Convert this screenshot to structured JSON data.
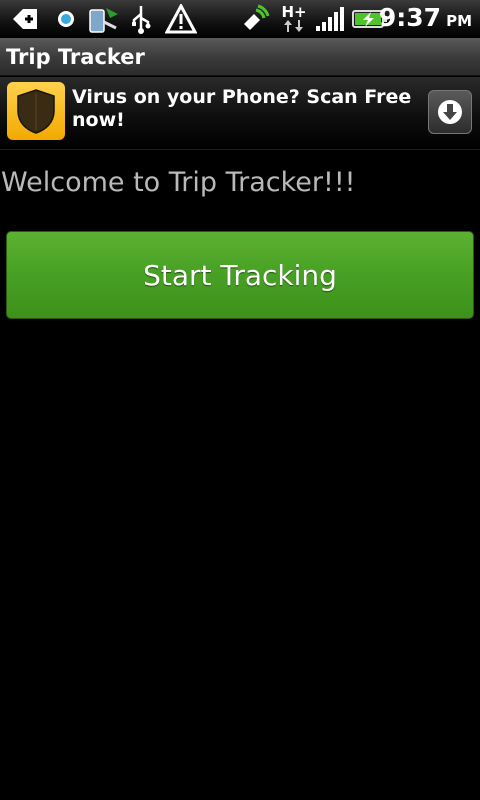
{
  "status_bar": {
    "time": "9:37",
    "ampm": "PM",
    "network_type": "H+",
    "icons": [
      "back-arrow-icon",
      "record-dot-icon",
      "sync-phone-icon",
      "usb-icon",
      "warning-icon",
      "gps-signal-icon",
      "data-arrows-icon",
      "signal-bars-icon",
      "battery-charging-icon"
    ]
  },
  "app": {
    "title": "Trip Tracker"
  },
  "ad": {
    "text": "Virus on your Phone? Scan Free now!"
  },
  "main": {
    "welcome_text": "Welcome to Trip Tracker!!!",
    "start_button_label": "Start Tracking"
  },
  "colors": {
    "button_green": "#47a024",
    "welcome_text": "#b9b9b9",
    "ad_logo": "#f2a900"
  }
}
